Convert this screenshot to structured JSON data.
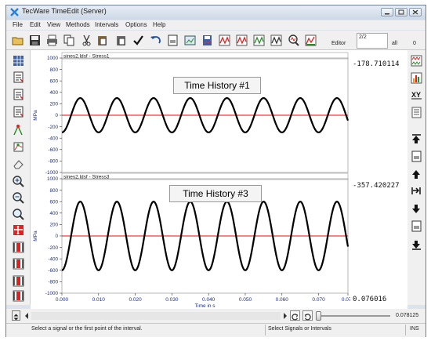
{
  "window": {
    "title": "TecWare TimeEdit (Server)",
    "accent": "#1f5fa8"
  },
  "menu": [
    "File",
    "Edit",
    "View",
    "Methods",
    "Intervals",
    "Options",
    "Help"
  ],
  "toolbar": {
    "icons": [
      "open-icon",
      "save-icon",
      "print-icon",
      "copy-icon",
      "cut-icon",
      "paste-icon",
      "paste-special-icon",
      "check-icon",
      "undo-icon",
      "page-icon",
      "export-icon",
      "save-signal-icon",
      "signal-red-icon",
      "signal-red-2-icon",
      "signal-green-icon",
      "signal-edit-icon",
      "zoom-signal-icon",
      "signal-chart-icon"
    ],
    "editor_label": "Editor",
    "editor_value": "2/2",
    "all_label": "all",
    "count": "0"
  },
  "left_toolbar_icons": [
    "grid-icon",
    "insert-icon",
    "insert-2-icon",
    "insert-3-icon",
    "point-edit-icon",
    "tool-icon",
    "eraser-icon",
    "zoom-in-icon",
    "zoom-out-icon",
    "zoom-icon",
    "move-icon",
    "filter-red-icon",
    "filter-red-2-icon",
    "filter-red-3-icon",
    "filter-red-4-icon"
  ],
  "right_toolbar_icons": [
    "multi-signal-icon",
    "spectrum-icon",
    "xy-icon",
    "list-icon",
    "first-icon",
    "page-up-icon",
    "up-icon",
    "goto-icon",
    "down-icon",
    "page-down-icon",
    "last-icon"
  ],
  "plots": [
    {
      "header": "sines2.ldsf - Stress1",
      "callout": "Time History #1",
      "ylabel": "MPa",
      "value": "-178.710114"
    },
    {
      "header": "sines2.ldsf - Stress3",
      "callout": "Time History #3",
      "ylabel": "MPa",
      "value": "-357.420227"
    }
  ],
  "xaxis": {
    "label": "Time in s",
    "ticks": [
      "0.000",
      "0.010",
      "0.020",
      "0.030",
      "0.040",
      "0.050",
      "0.060",
      "0.070",
      "0.078"
    ]
  },
  "cursor_value": "0.076016",
  "slider_value": "0.078125",
  "status": {
    "left": "Select a signal or the first point of the interval.",
    "middle": "Select Signals or Intervals",
    "right": "INS"
  },
  "chart_data": [
    {
      "type": "line",
      "title": "sines2.ldsf - Stress1",
      "xlabel": "Time in s",
      "ylabel": "MPa",
      "xlim": [
        0,
        0.078
      ],
      "ylim": [
        -1000,
        1000
      ],
      "y_ticks": [
        1000,
        800,
        600,
        400,
        200,
        0,
        -200,
        -400,
        -600,
        -800,
        -1000
      ],
      "series": [
        {
          "amplitude": 300,
          "period": 0.01,
          "phase_at_zero": -300,
          "color": "#000000"
        }
      ],
      "zero_line_color": "#ff0000"
    },
    {
      "type": "line",
      "title": "sines2.ldsf - Stress3",
      "xlabel": "Time in s",
      "ylabel": "MPa",
      "xlim": [
        0,
        0.078
      ],
      "ylim": [
        -1000,
        1000
      ],
      "y_ticks": [
        1000,
        800,
        600,
        400,
        200,
        0,
        -200,
        -400,
        -600,
        -800,
        -1000
      ],
      "series": [
        {
          "amplitude": 600,
          "period": 0.01,
          "phase_at_zero": -600,
          "color": "#000000"
        }
      ],
      "zero_line_color": "#ff0000"
    }
  ]
}
